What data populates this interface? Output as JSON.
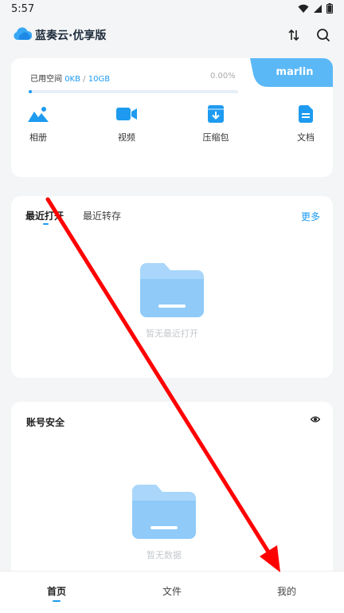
{
  "status_bar": {
    "time": "5:57"
  },
  "header": {
    "title": "蓝奏云·优享版",
    "sort_icon": "sort-icon",
    "search_icon": "search-icon"
  },
  "storage": {
    "user": "marlin",
    "label": "已用空间",
    "used": "0KB",
    "separator": "/",
    "total": "10GB",
    "percent_text": "0.00%",
    "percent": 0
  },
  "categories": [
    {
      "label": "相册",
      "icon": "image-icon"
    },
    {
      "label": "视频",
      "icon": "video-icon"
    },
    {
      "label": "压缩包",
      "icon": "archive-icon"
    },
    {
      "label": "文档",
      "icon": "document-icon"
    }
  ],
  "recent": {
    "tabs": [
      "最近打开",
      "最近转存"
    ],
    "more": "更多",
    "empty_text": "暂无最近打开"
  },
  "security": {
    "title": "账号安全",
    "empty_text": "暂无数据"
  },
  "bottom_nav": [
    "首页",
    "文件",
    "我的"
  ],
  "colors": {
    "accent": "#1e9bf0",
    "annotation_arrow": "#ff0000"
  }
}
